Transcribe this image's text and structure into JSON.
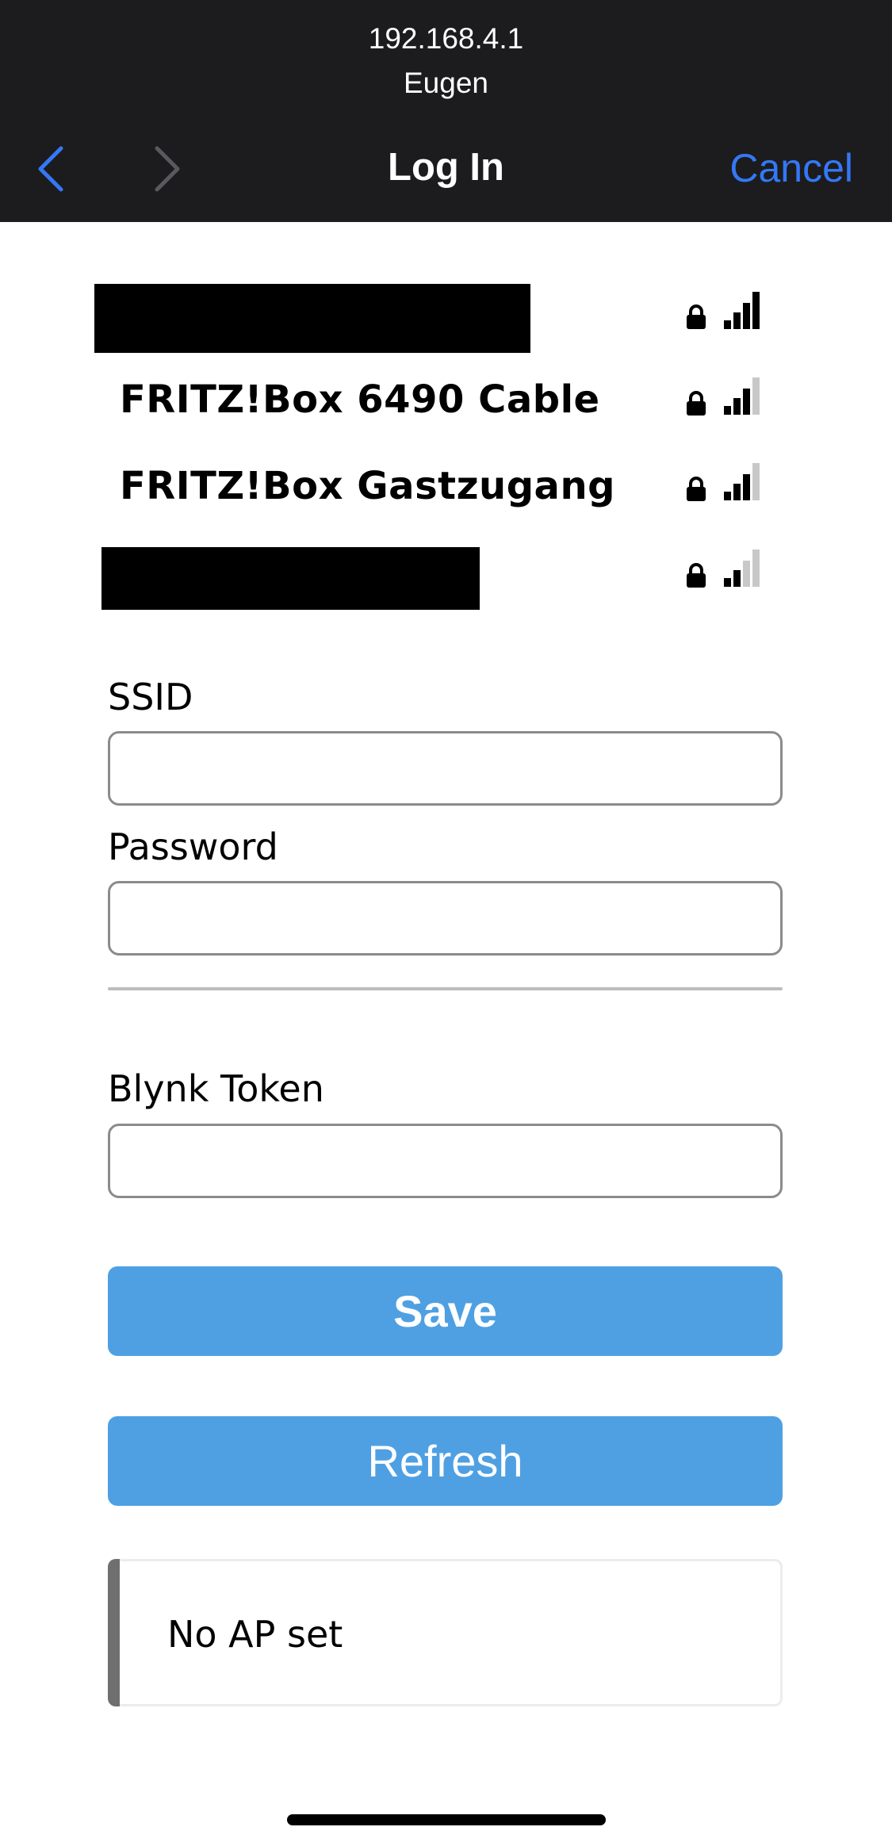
{
  "browser": {
    "address": "192.168.4.1",
    "subtitle": "Eugen",
    "title": "Log In",
    "cancel_label": "Cancel"
  },
  "networks": [
    {
      "name": "",
      "redacted": true,
      "locked": true,
      "signal_bars": 4
    },
    {
      "name": "FRITZ!Box 6490 Cable",
      "redacted": false,
      "locked": true,
      "signal_bars": 3
    },
    {
      "name": "FRITZ!Box Gastzugang",
      "redacted": false,
      "locked": true,
      "signal_bars": 3
    },
    {
      "name": "",
      "redacted": true,
      "locked": true,
      "signal_bars": 2
    }
  ],
  "form": {
    "ssid_label": "SSID",
    "ssid_value": "",
    "password_label": "Password",
    "password_value": "",
    "token_label": "Blynk Token",
    "token_value": ""
  },
  "buttons": {
    "save_label": "Save",
    "refresh_label": "Refresh"
  },
  "status": {
    "message": "No AP set"
  },
  "colors": {
    "header_bg": "#1c1c1e",
    "accent": "#3478f6",
    "button_bg": "#4fa0e3",
    "signal_active": "#000000",
    "signal_inactive": "#c8c8c8"
  }
}
